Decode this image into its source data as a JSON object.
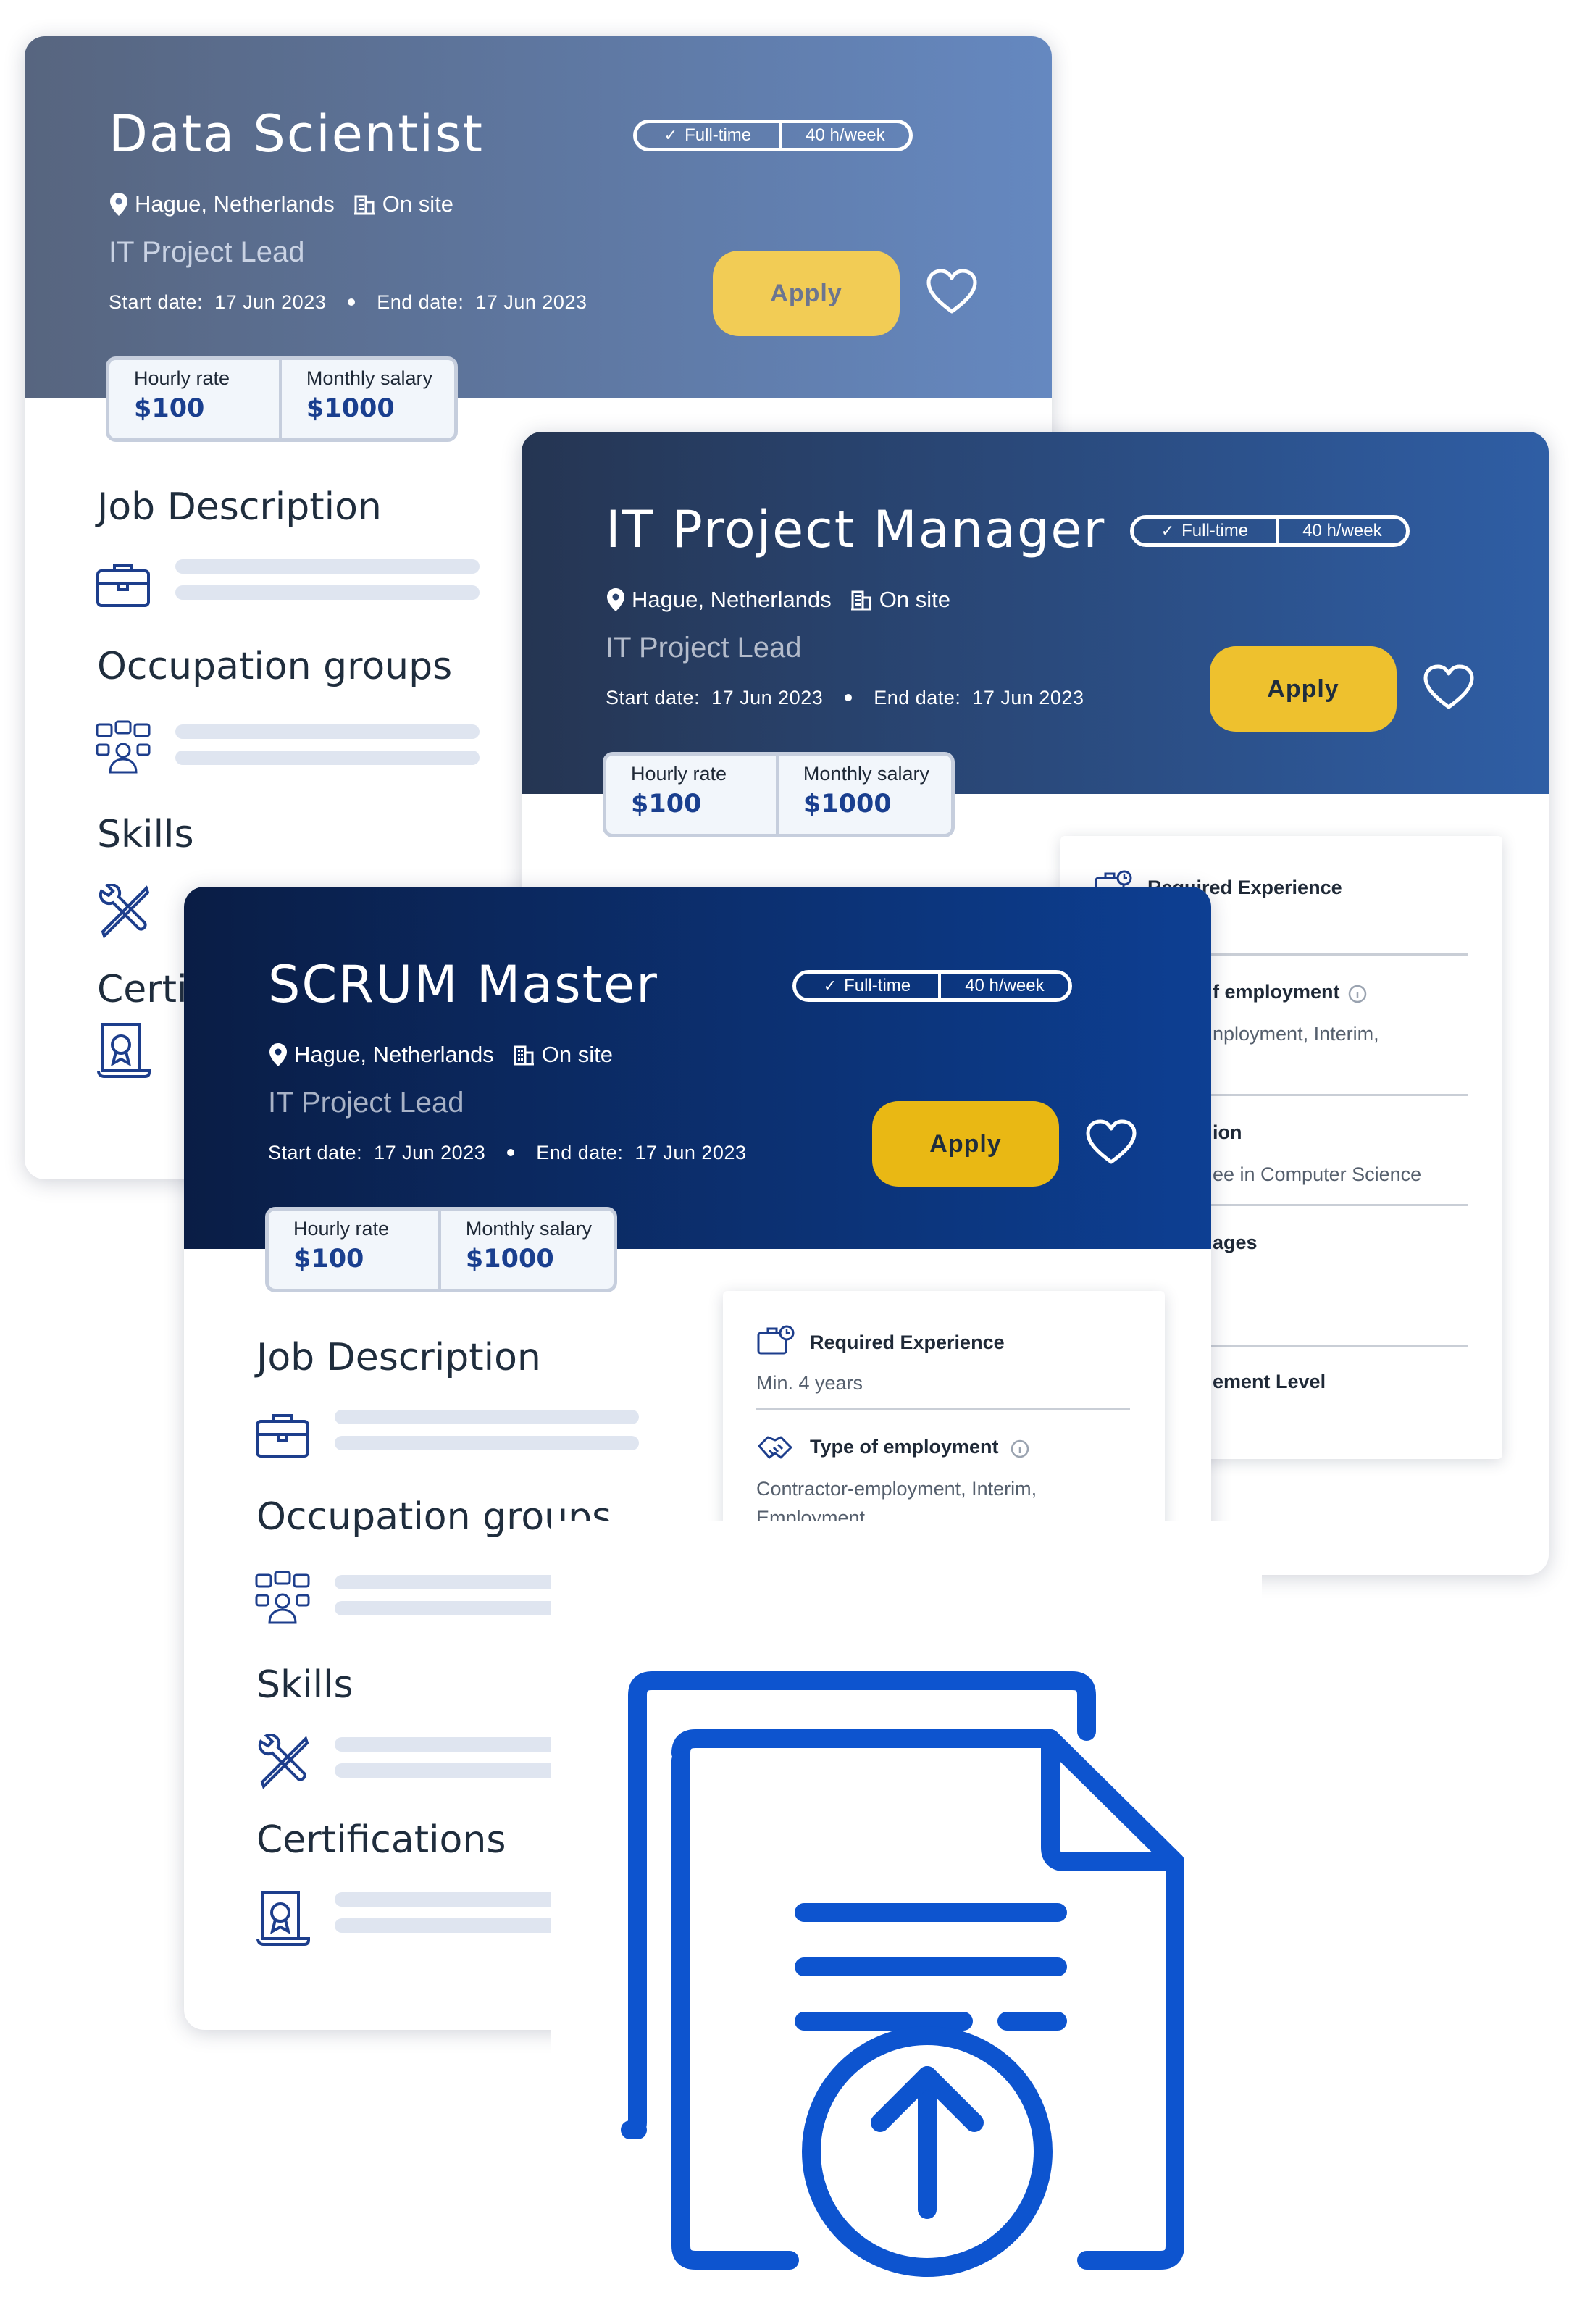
{
  "location": "Hague, Netherlands",
  "work_mode": "On site",
  "subtitle": "IT Project Lead",
  "start_label": "Start date:",
  "start_value": "17 Jun 2023",
  "end_label": "End date:",
  "end_value": "17 Jun 2023",
  "badge_fulltime": "Full-time",
  "badge_hours": "40 h/week",
  "apply_label": "Apply",
  "hourly_label": "Hourly rate",
  "hourly_value": "$100",
  "monthly_label": "Monthly salary",
  "monthly_value": "$1000",
  "sections": {
    "job_description": "Job Description",
    "occupation_groups": "Occupation groups",
    "skills": "Skills",
    "certifications": "Certifications",
    "certifications_partial": "Certi",
    "occupation_groups_partial": "Occupation groups"
  },
  "cards": {
    "data_scientist": {
      "title": "Data Scientist"
    },
    "it_project_manager": {
      "title": "IT Project Manager",
      "panel": {
        "required_experience": "Required Experience",
        "type_of_employment_partial": "f employment",
        "employment_partial": "nployment, Interim,",
        "education_partial": "ion",
        "degree_partial": "ee in Computer Science",
        "languages_partial": "ages",
        "level_partial": "ement Level"
      }
    },
    "scrum_master": {
      "title": "SCRUM Master",
      "panel": {
        "required_experience": "Required Experience",
        "min_years": "Min. 4 years",
        "type_of_employment": "Type of employment",
        "employment_line1": "Contractor-employment, Interim,",
        "employment_line2": "Employment"
      }
    }
  },
  "colors": {
    "header1_start": "#57657f",
    "header1_end": "#6588c0",
    "header2_start": "#253552",
    "header2_end": "#2f5ea5",
    "header3_start": "#0a1d45",
    "header3_end": "#0d3f93",
    "apply_light": "#f2cc55",
    "apply_mid": "#eec12e",
    "apply_dark": "#e9b814",
    "upload_blue": "#0d54cf",
    "icon_blue": "#1d3e8c"
  }
}
